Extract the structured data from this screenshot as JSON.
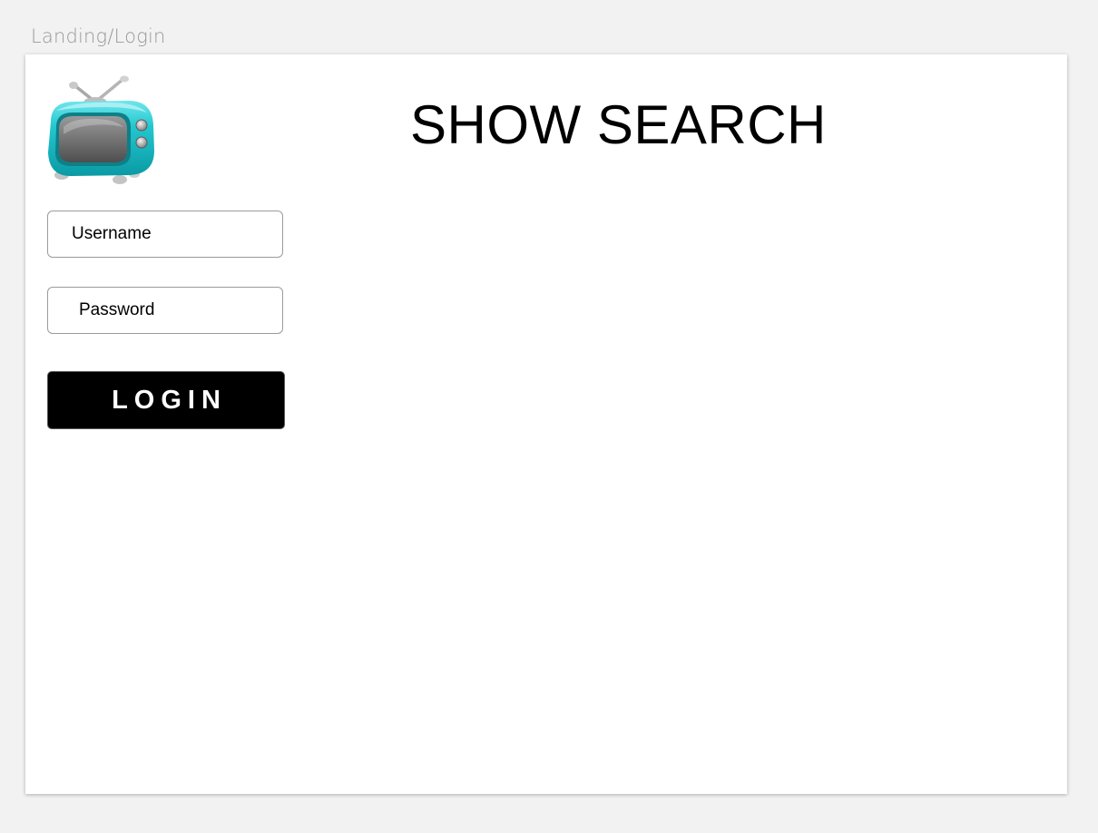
{
  "artboard": {
    "label": "Landing/Login"
  },
  "header": {
    "title": "SHOW SEARCH",
    "logo_icon": "retro-tv-icon"
  },
  "login_form": {
    "username_placeholder": "Username",
    "password_placeholder": "Password",
    "login_label": "LOGIN"
  },
  "colors": {
    "background": "#f2f2f2",
    "artboard": "#ffffff",
    "tv_teal": "#1fc3cc",
    "button": "#000000",
    "button_text": "#ffffff",
    "field_border": "#9b9b9b",
    "label_gray": "#999999"
  }
}
